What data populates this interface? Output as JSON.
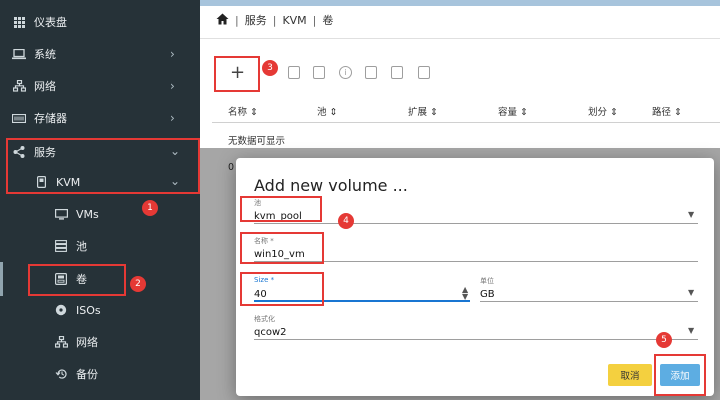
{
  "sidebar": {
    "items": [
      {
        "label": "仪表盘",
        "icon": "grid-icon"
      },
      {
        "label": "系统",
        "icon": "laptop-icon"
      },
      {
        "label": "网络",
        "icon": "network-icon"
      },
      {
        "label": "存储器",
        "icon": "storage-icon"
      },
      {
        "label": "服务",
        "icon": "share-icon"
      },
      {
        "label": "KVM",
        "icon": "phone-icon"
      },
      {
        "label": "VMs",
        "icon": "monitor-icon"
      },
      {
        "label": "池",
        "icon": "server-icon"
      },
      {
        "label": "卷",
        "icon": "disk-icon"
      },
      {
        "label": "ISOs",
        "icon": "disc-icon"
      },
      {
        "label": "网络",
        "icon": "network-icon"
      },
      {
        "label": "备份",
        "icon": "history-icon"
      }
    ],
    "chevron_right": "›",
    "chevron_down": "⌄"
  },
  "breadcrumb": {
    "home_icon": "home-icon",
    "items": [
      "服务",
      "KVM",
      "卷"
    ],
    "separator": "|"
  },
  "toolbar": {
    "add_label": "+"
  },
  "table": {
    "columns": [
      "名称 ⇕",
      "池 ⇕",
      "扩展 ⇕",
      "容量 ⇕",
      "划分 ⇕",
      "路径 ⇕"
    ],
    "empty_text": "无数据可显示",
    "row_count_text": "0"
  },
  "dialog": {
    "title": "Add new volume ...",
    "pool": {
      "label": "池",
      "value": "kvm_pool"
    },
    "name": {
      "label": "名称 *",
      "value": "win10_vm"
    },
    "size": {
      "label": "Size *",
      "value": "40"
    },
    "unit": {
      "label": "单位",
      "value": "GB"
    },
    "format": {
      "label": "格式化",
      "value": "qcow2"
    },
    "cancel_label": "取消",
    "add_label": "添加"
  },
  "annotations": {
    "badges": [
      "1",
      "2",
      "3",
      "4",
      "5"
    ]
  },
  "colors": {
    "sidebar_bg": "#263238",
    "highlight": "#e53935",
    "primary": "#1976d2",
    "cancel_btn": "#f4d03f",
    "add_btn": "#5dade2"
  }
}
